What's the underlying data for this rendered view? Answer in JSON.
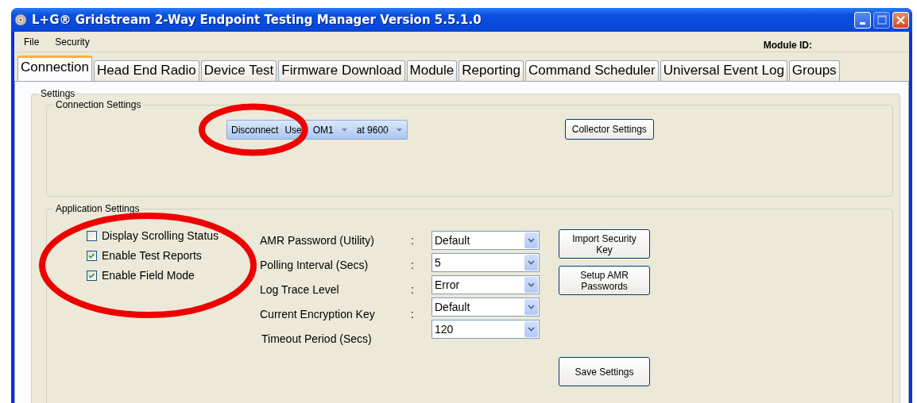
{
  "window": {
    "title": "L+G® Gridstream 2-Way Endpoint Testing Manager Version 5.5.1.0"
  },
  "menu": [
    "File",
    "Security"
  ],
  "module_id_label": "Module ID:",
  "tabs": [
    {
      "label": "Connection",
      "selected": true
    },
    {
      "label": "Head End Radio",
      "selected": false
    },
    {
      "label": "Device Test",
      "selected": false
    },
    {
      "label": "Firmware Download",
      "selected": false
    },
    {
      "label": "Module",
      "selected": false
    },
    {
      "label": "Reporting",
      "selected": false
    },
    {
      "label": "Command Scheduler",
      "selected": false
    },
    {
      "label": "Universal Event Log",
      "selected": false
    },
    {
      "label": "Groups",
      "selected": false
    }
  ],
  "settings": {
    "title": "Settings",
    "connection_settings": {
      "title": "Connection Settings",
      "connect_button": "Disconnect",
      "port_label": "Use",
      "port": "OM1",
      "baud": "at 9600",
      "collector_button": "Collector Settings",
      "circled": true
    },
    "application_settings": {
      "title": "Application Settings",
      "checkboxes_circled": true,
      "checkboxes": [
        {
          "label": "Display Scrolling Status",
          "checked": false
        },
        {
          "label": "Enable Test Reports",
          "checked": true
        },
        {
          "label": "Enable Field Mode",
          "checked": true
        }
      ],
      "fields": [
        {
          "label": "AMR Password (Utility)",
          "separator": ":",
          "value": "Default"
        },
        {
          "label": "Polling Interval (Secs)",
          "separator": ":",
          "value": "5"
        },
        {
          "label": "Log Trace Level",
          "separator": ":",
          "value": "Error"
        },
        {
          "label": "Current Encryption Key",
          "separator": ":",
          "value": "Default"
        },
        {
          "label": "Timeout Period (Secs)",
          "value": "120"
        }
      ],
      "buttons": [
        "Import Security Key",
        "Setup AMR Passwords"
      ],
      "save_button": "Save Settings"
    }
  }
}
